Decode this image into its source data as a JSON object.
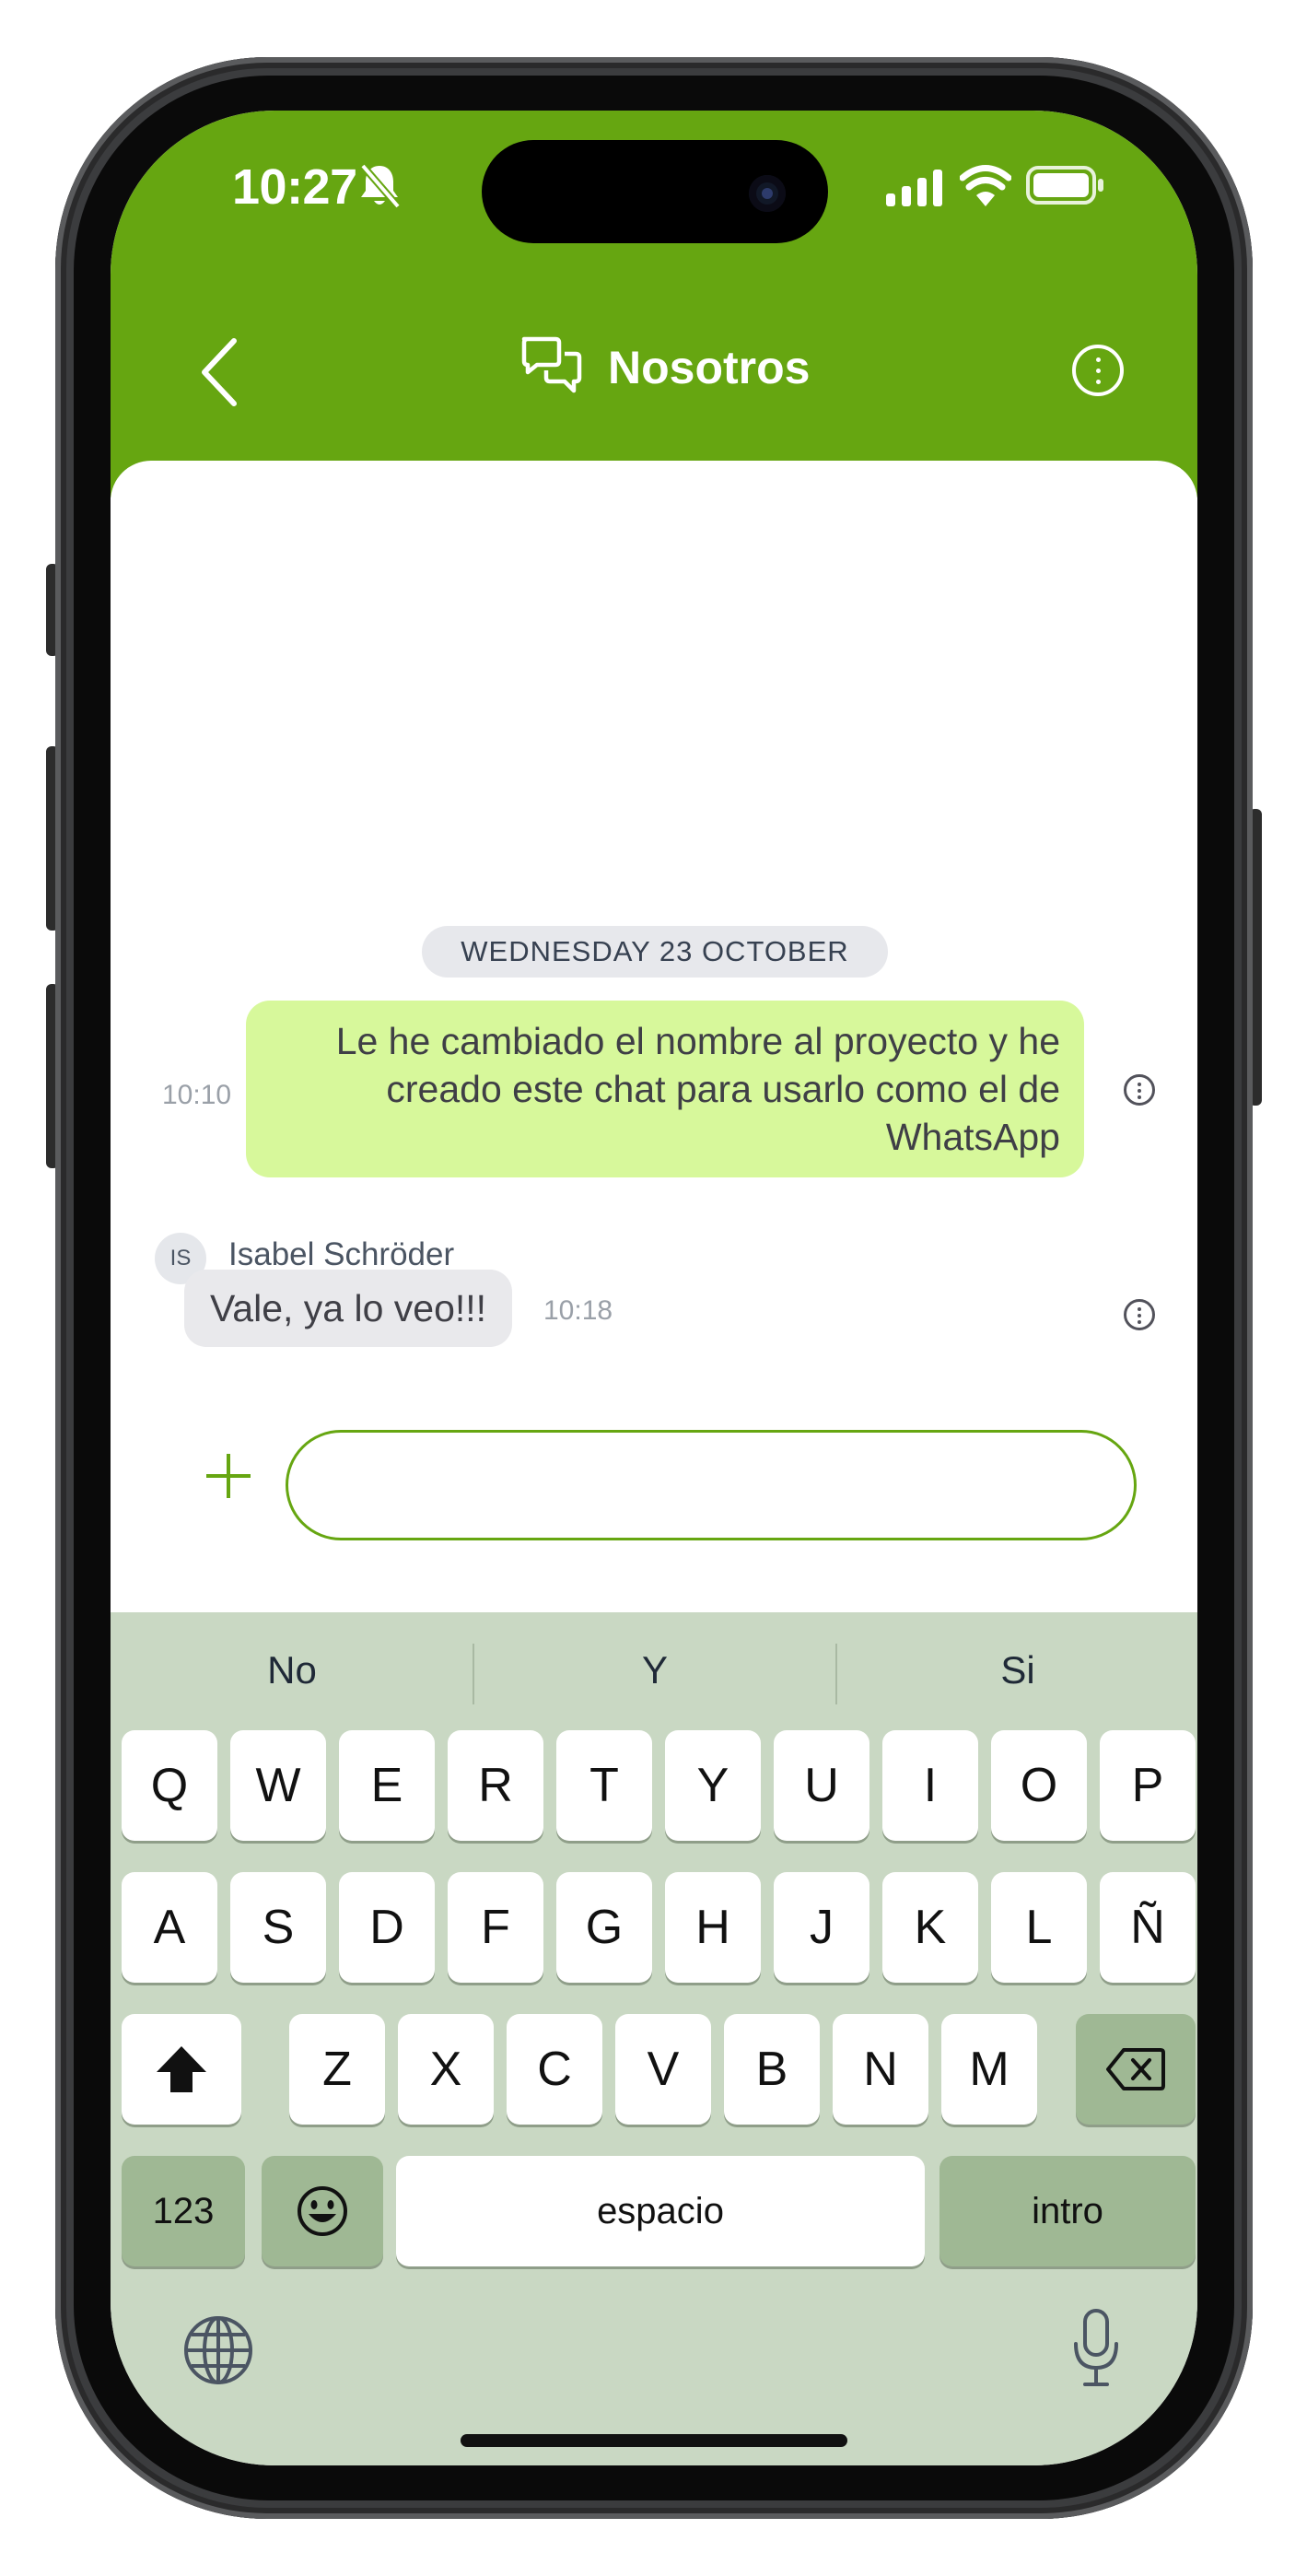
{
  "status_bar": {
    "time": "10:27"
  },
  "header": {
    "title": "Nosotros"
  },
  "chat": {
    "date_separator": "WEDNESDAY 23 OCTOBER",
    "messages": [
      {
        "direction": "outgoing",
        "time": "10:10",
        "lines": [
          "Le he cambiado el nombre al proyecto y he",
          "creado este chat para usarlo como el de",
          "WhatsApp"
        ]
      },
      {
        "direction": "incoming",
        "avatar_initials": "IS",
        "sender": "Isabel Schröder",
        "text": "Vale, ya lo veo!!!",
        "time": "10:18"
      }
    ]
  },
  "composer": {
    "value": "",
    "placeholder": ""
  },
  "keyboard": {
    "suggestions": [
      "No",
      "Y",
      "Si"
    ],
    "row1": [
      "Q",
      "W",
      "E",
      "R",
      "T",
      "Y",
      "U",
      "I",
      "O",
      "P"
    ],
    "row2": [
      "A",
      "S",
      "D",
      "F",
      "G",
      "H",
      "J",
      "K",
      "L",
      "Ñ"
    ],
    "row3": [
      "Z",
      "X",
      "C",
      "V",
      "B",
      "N",
      "M"
    ],
    "numbers_label": "123",
    "space_label": "espacio",
    "return_label": "intro"
  },
  "colors": {
    "header_green": "#66a611",
    "outgoing_bubble": "#d7f89b",
    "incoming_bubble": "#e9e9ec",
    "keyboard_bg": "#c9d8c3",
    "keyboard_dark_key": "#9fb894"
  },
  "icons": {
    "back": "chevron-left-icon",
    "chat": "chat-bubbles-icon",
    "options": "more-vertical-icon",
    "message_info": "more-vertical-icon",
    "attach": "plus-icon",
    "shift": "shift-arrow-icon",
    "delete": "backspace-icon",
    "emoji": "emoji-icon",
    "globe": "globe-icon",
    "mic": "microphone-icon"
  }
}
